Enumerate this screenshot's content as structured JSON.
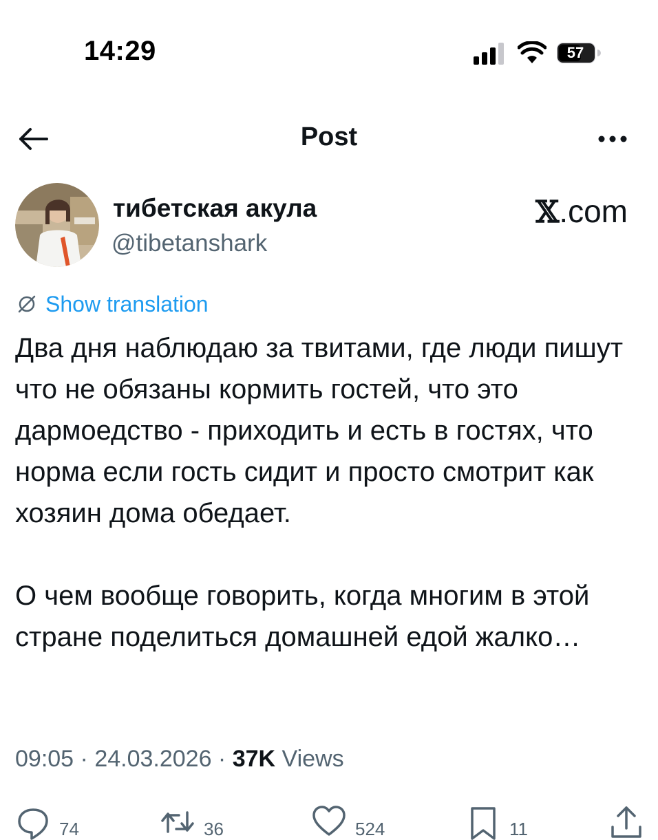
{
  "status_bar": {
    "time": "14:29",
    "battery": "57"
  },
  "nav": {
    "title": "Post"
  },
  "author": {
    "display_name": "тибетская акула",
    "handle": "@tibetanshark"
  },
  "watermark": {
    "x": "𝕏",
    "suffix": ".com"
  },
  "translation": {
    "label": "Show translation"
  },
  "tweet": {
    "paragraph_1": "Два дня наблюдаю за твитами, где люди пишут что не обязаны кормить гостей, что это дармоедство - приходить и есть в гостях, что норма если гость сидит и просто смотрит как хозяин дома обедает.",
    "paragraph_2": "О чем вообще говорить, когда многим в этой стране поделиться домашней едой жалко…"
  },
  "meta": {
    "time": "09:05",
    "sep1": " · ",
    "date": "24.03.2026",
    "sep2": " · ",
    "views_count": "37K",
    "views_label": " Views"
  },
  "actions": {
    "replies": "74",
    "reposts": "36",
    "likes": "524",
    "bookmarks": "11"
  },
  "icons": {
    "back": "arrow-left-icon",
    "more": "more-horizontal-icon",
    "translate": "globe-icon",
    "reply": "reply-icon",
    "repost": "repost-icon",
    "like": "heart-icon",
    "bookmark": "bookmark-icon",
    "share": "share-icon"
  },
  "colors": {
    "link": "#1d9bf0",
    "secondary_text": "#536471",
    "primary_text": "#0f1419"
  }
}
